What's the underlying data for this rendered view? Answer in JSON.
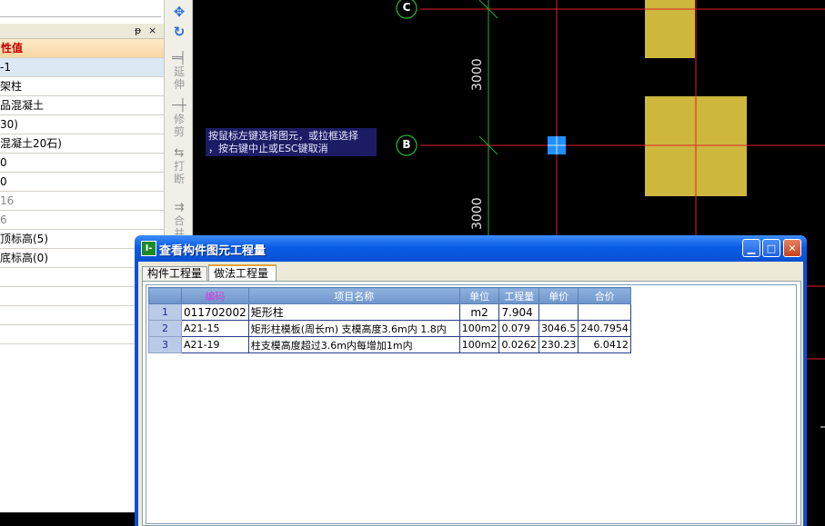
{
  "left_panel": {
    "header": "性值",
    "rows": [
      {
        "value": "-1",
        "selected": true
      },
      {
        "value": "架柱"
      },
      {
        "value": "品混凝土"
      },
      {
        "value": "30)"
      },
      {
        "value": "混凝土20石)"
      },
      {
        "value": "0"
      },
      {
        "value": "0"
      },
      {
        "value": "16",
        "gray": true
      },
      {
        "value": "6",
        "gray": true
      },
      {
        "value": "顶标高(5)"
      },
      {
        "value": "底标高(0)"
      },
      {
        "value": ""
      },
      {
        "value": ""
      },
      {
        "value": ""
      },
      {
        "value": ""
      }
    ],
    "pin_glyph": "ᵽ",
    "close_glyph": "×"
  },
  "toolbar": {
    "extend": "延伸",
    "trim": "修剪",
    "break": "打断",
    "merge": "合并"
  },
  "cad": {
    "hint_line1": "按鼠标左键选择图元，或拉框选择",
    "hint_line2": "，按右键中止或ESC键取消",
    "axis_c": "C",
    "axis_b": "B",
    "dim_upper": "3000",
    "dim_lower": "3000",
    "colors": {
      "grid_red": "#e0202a",
      "grid_green": "#22b030",
      "column_fill": "#cdb73c",
      "selection_blue": "#1e90ff"
    }
  },
  "dialog": {
    "title": "查看构件图元工程量",
    "app_icon": "I-",
    "tabs": [
      {
        "label": "构件工程量",
        "active": false
      },
      {
        "label": "做法工程量",
        "active": true
      }
    ],
    "table": {
      "headers": [
        "",
        "编码",
        "项目名称",
        "单位",
        "工程量",
        "单价",
        "合价"
      ],
      "rows": [
        [
          "1",
          "011702002",
          "矩形柱",
          "m2",
          "7.904",
          "",
          ""
        ],
        [
          "2",
          "A21-15",
          "矩形柱模板(周长m) 支模高度3.6m内 1.8内",
          "100m2",
          "0.079",
          "3046.5",
          "240.7954"
        ],
        [
          "3",
          "A21-19",
          "柱支模高度超过3.6m内每增加1m内",
          "100m2",
          "0.0262",
          "230.23",
          "6.0412"
        ]
      ]
    }
  }
}
